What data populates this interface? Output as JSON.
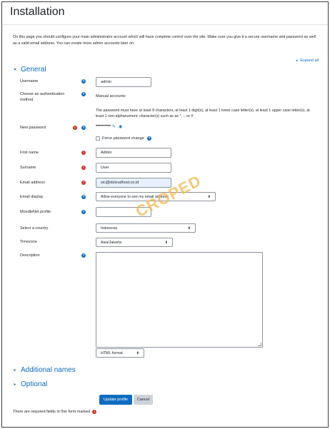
{
  "page": {
    "title": "Installation"
  },
  "intro": "On this page you should configure your main administrator account which will have complete control over the site. Make sure you give it a secure username and password as well as a valid email address. You can create more admin accounts later on.",
  "expand_all": "Expand all",
  "sections": {
    "general": "General",
    "additional_names": "Additional names",
    "optional": "Optional"
  },
  "fields": {
    "username": {
      "label": "Username",
      "value": "admin"
    },
    "auth_method": {
      "label": "Choose an authentication method",
      "value": "Manual accounts"
    },
    "password_policy": "The password must have at least 8 characters, at least 1 digit(s), at least 1 lower case letter(s), at least 1 upper case letter(s), at least 1 non-alphanumeric character(s) such as as *, -, or #",
    "new_password": {
      "label": "New password",
      "value": "••••••••••"
    },
    "force_password_change": "Force password change",
    "first_name": {
      "label": "First name",
      "value": "Admin"
    },
    "surname": {
      "label": "Surname",
      "value": "User"
    },
    "email": {
      "label": "Email address",
      "value": "sic@idcloudhost.co.id"
    },
    "email_display": {
      "label": "Email display",
      "value": "Allow everyone to see my email address"
    },
    "moodlenet_profile": {
      "label": "MoodleNet profile",
      "value": ""
    },
    "country": {
      "label": "Select a country",
      "value": "Indonesia"
    },
    "timezone": {
      "label": "Timezone",
      "value": "Asia/Jakarta"
    },
    "description": {
      "label": "Description",
      "format": "HTML format"
    }
  },
  "buttons": {
    "update": "Update profile",
    "cancel": "Cancel"
  },
  "footer_note": "There are required fields in this form marked",
  "watermark": "CROPED",
  "icons": {
    "required": "exclamation-circle",
    "help": "question-circle",
    "edit": "pencil",
    "reveal": "eye"
  },
  "colors": {
    "accent": "#0f6cbf",
    "required": "#ca3120",
    "watermark": "#f2b84b"
  }
}
